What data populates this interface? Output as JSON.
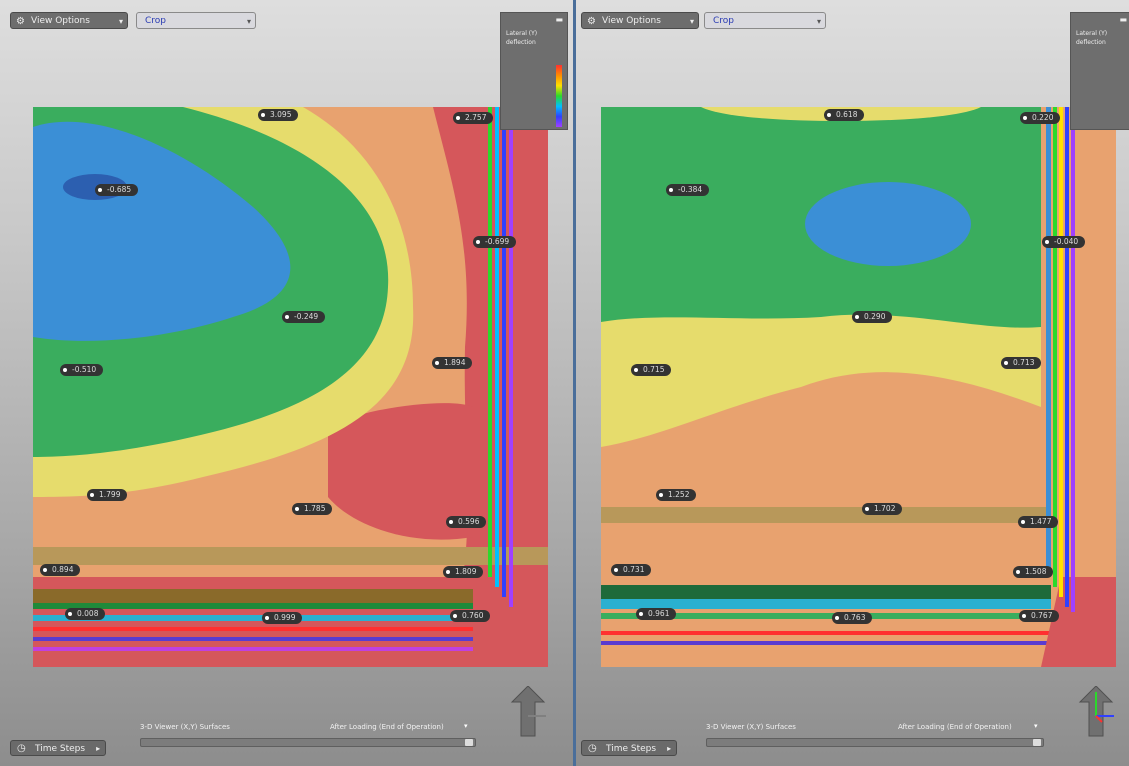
{
  "left": {
    "view_options_label": "View Options",
    "crop_label": "Crop",
    "scale_title": "Lateral (Y) deflection",
    "labels": [
      "3.095",
      "2.757",
      "-0.685",
      "-0.699",
      "-0.249",
      "-0.510",
      "1.894",
      "1.799",
      "1.785",
      "0.596",
      "1.809",
      "0.008",
      "0.999",
      "0.760",
      "0.894"
    ],
    "time_steps_label": "Time Steps",
    "caption_left": "3-D Viewer (X,Y) Surfaces",
    "caption_right": "After Loading (End of Operation)"
  },
  "right": {
    "view_options_label": "View Options",
    "crop_label": "Crop",
    "scale_title": "Lateral (Y) deflection",
    "labels": [
      "0.618",
      "0.220",
      "-0.384",
      "-0.040",
      "0.290",
      "0.715",
      "0.713",
      "1.252",
      "1.702",
      "1.477",
      "1.508",
      "0.731",
      "0.961",
      "0.763",
      "0.767"
    ],
    "time_steps_label": "Time Steps",
    "caption_left": "3-D Viewer (X,Y) Surfaces",
    "caption_right": "After Loading (End of Operation)"
  },
  "contour_colors": {
    "red": "#d5575b",
    "orange": "#e8a26f",
    "yellow": "#e6dc6c",
    "green": "#3aad5e",
    "blue": "#3b8fd6",
    "dark_blue": "#2c5fb0"
  }
}
